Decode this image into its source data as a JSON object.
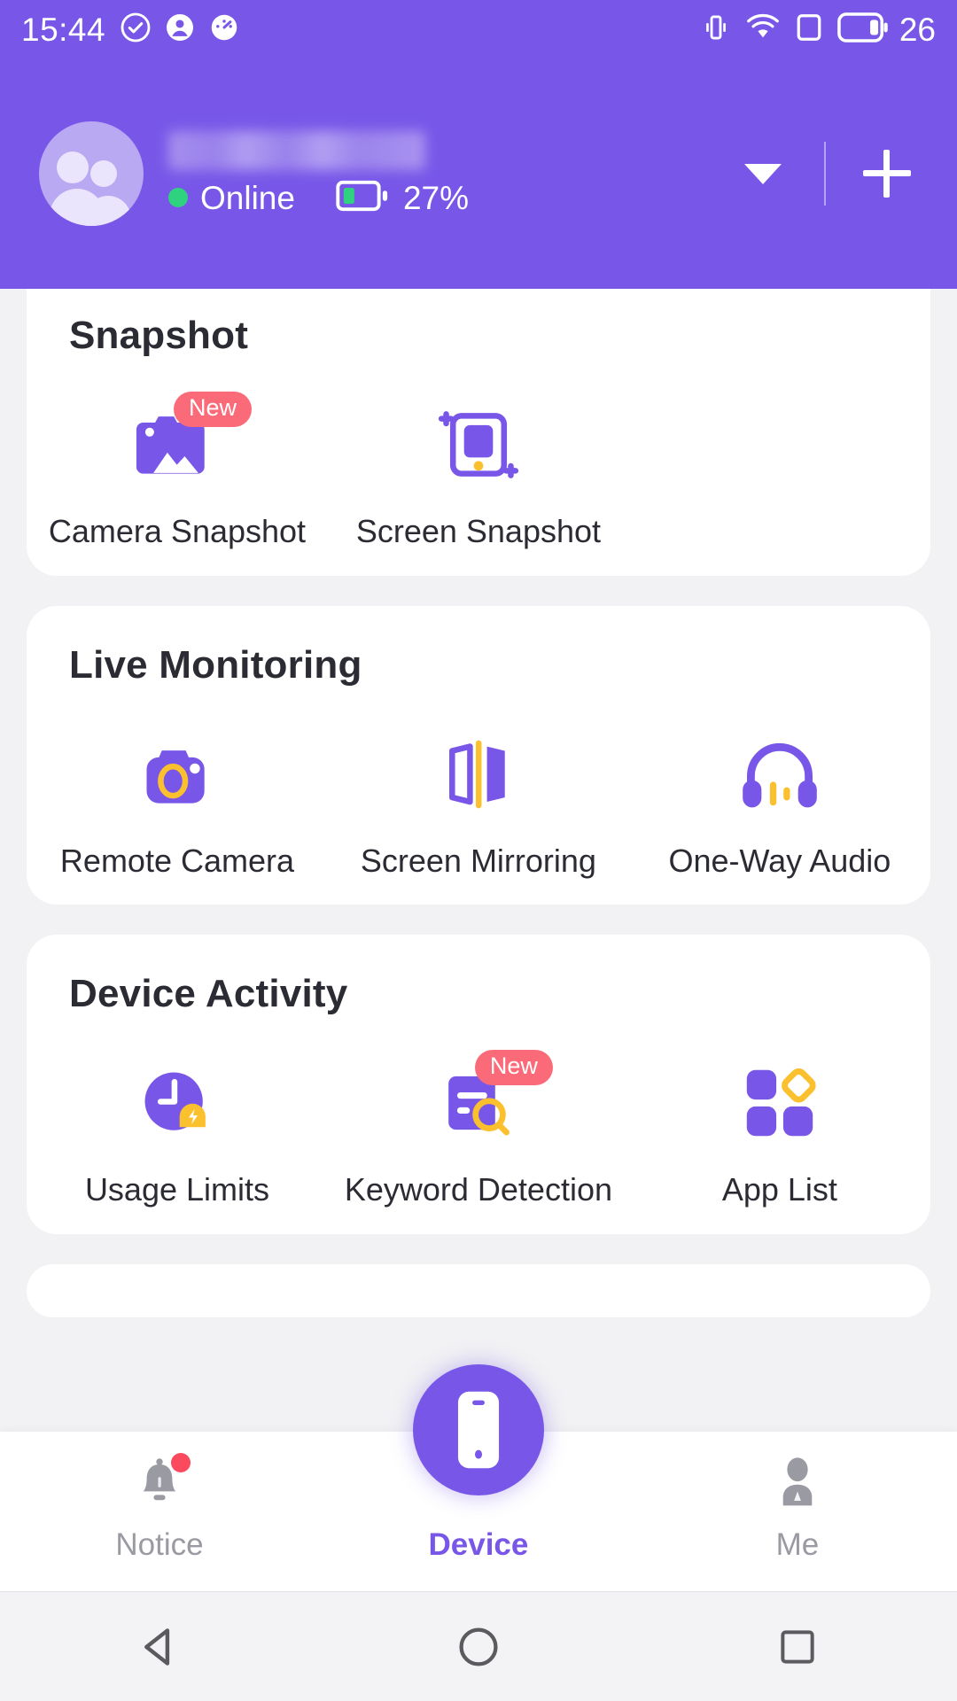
{
  "status_bar": {
    "time": "15:44",
    "battery_level": "26",
    "left_icons": [
      "check-circle-icon",
      "account-icon",
      "speedometer-icon"
    ],
    "right_icons": [
      "vibrate-icon",
      "wifi-icon",
      "sim-card-icon",
      "battery-icon"
    ]
  },
  "header": {
    "device_name": "",
    "device_name_redacted": true,
    "online_status": "Online",
    "battery_percent": "27%",
    "dropdown_icon": "chevron-down-icon",
    "add_icon": "plus-icon",
    "background_color": "#7857e8"
  },
  "sections": [
    {
      "title": "Snapshot",
      "items": [
        {
          "label": "Camera Snapshot",
          "icon": "camera-snapshot-icon",
          "badge": "New"
        },
        {
          "label": "Screen Snapshot",
          "icon": "screen-snapshot-icon",
          "badge": ""
        }
      ]
    },
    {
      "title": "Live Monitoring",
      "items": [
        {
          "label": "Remote Camera",
          "icon": "remote-camera-icon",
          "badge": ""
        },
        {
          "label": "Screen Mirroring",
          "icon": "screen-mirroring-icon",
          "badge": ""
        },
        {
          "label": "One-Way Audio",
          "icon": "headphones-icon",
          "badge": ""
        }
      ]
    },
    {
      "title": "Device Activity",
      "items": [
        {
          "label": "Usage Limits",
          "icon": "usage-limits-icon",
          "badge": ""
        },
        {
          "label": "Keyword\nDetection",
          "icon": "keyword-detection-icon",
          "badge": "New"
        },
        {
          "label": "App List",
          "icon": "app-list-icon",
          "badge": ""
        }
      ]
    }
  ],
  "tab_bar": {
    "tabs": [
      {
        "label": "Notice",
        "icon": "bell-icon",
        "active": false,
        "has_dot": true
      },
      {
        "label": "Device",
        "icon": "phone-icon",
        "active": true,
        "has_dot": false
      },
      {
        "label": "Me",
        "icon": "person-icon",
        "active": false,
        "has_dot": false
      }
    ]
  },
  "nav_bar": {
    "buttons": [
      {
        "name": "back",
        "icon": "triangle-back-icon"
      },
      {
        "name": "home",
        "icon": "circle-home-icon"
      },
      {
        "name": "recents",
        "icon": "square-recents-icon"
      }
    ]
  },
  "colors": {
    "primary": "#7857e8",
    "accent_yellow": "#fbc02d",
    "badge_red": "#fb6a78",
    "online_green": "#2fd27f",
    "page_bg": "#f2f2f4"
  }
}
